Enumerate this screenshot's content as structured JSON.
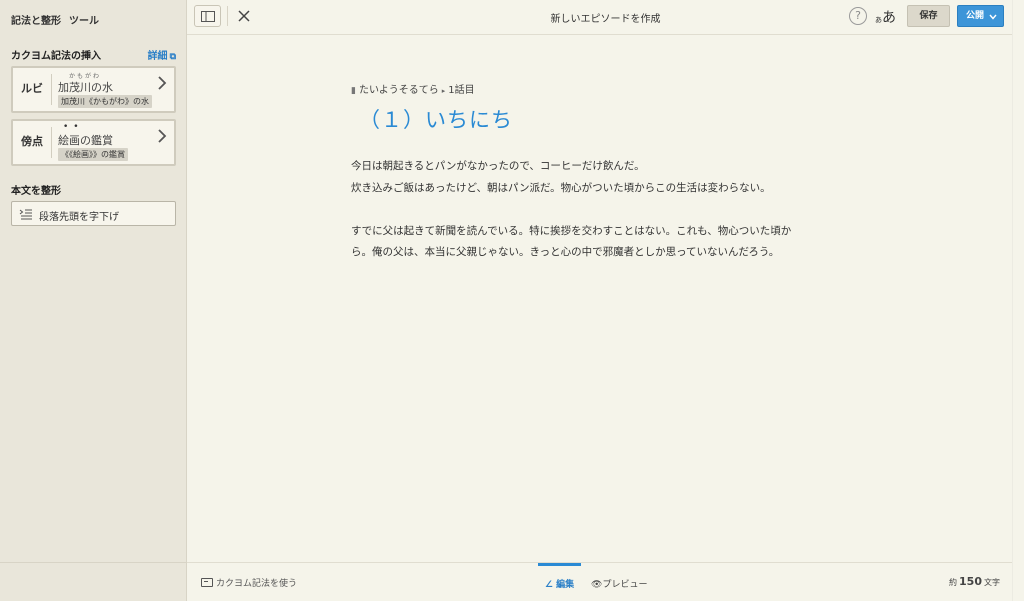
{
  "sidebar": {
    "title": "記法と整形",
    "title_suffix": "ツール",
    "insert_section": "カクヨム記法の挿入",
    "detail_link": "詳細",
    "ruby_card": {
      "label": "ルビ",
      "ruby_text": "かもがわ",
      "main": "加茂川の水",
      "code": "加茂川《かもがわ》の水"
    },
    "emphasis_card": {
      "label": "傍点",
      "dots": "••",
      "main": "絵画の鑑賞",
      "code": "《《絵画》》の鑑賞"
    },
    "format_section": "本文を整形",
    "indent_button": "段落先頭を字下げ"
  },
  "topbar": {
    "title": "新しいエピソードを作成",
    "help": "?",
    "font_small": "あ",
    "font_large": "あ",
    "save": "保存",
    "publish": "公開"
  },
  "editor": {
    "work_title": "たいようそるてら",
    "episode_label": "1話目",
    "episode_title": "（１）いちにち",
    "lines": [
      "今日は朝起きるとパンがなかったので、コーヒーだけ飲んだ。",
      "炊き込みご飯はあったけど、朝はパン派だ。物心がついた頃からこの生活は変わらない。",
      "",
      "すでに父は起きて新聞を読んでいる。特に挨拶を交わすことはない。これも、物心ついた頃か",
      "ら。俺の父は、本当に父親じゃない。きっと心の中で邪魔者としか思っていないんだろう。"
    ]
  },
  "bottombar": {
    "help_link": "カクヨム記法を使う",
    "tab_edit": "編集",
    "tab_preview": "プレビュー",
    "count_prefix": "約",
    "count": "150",
    "count_suffix": "文字"
  },
  "colors": {
    "accent": "#2a8ad4",
    "publish": "#3d95d8",
    "background": "#f5f4ea",
    "sidebar": "#e9e6da"
  }
}
